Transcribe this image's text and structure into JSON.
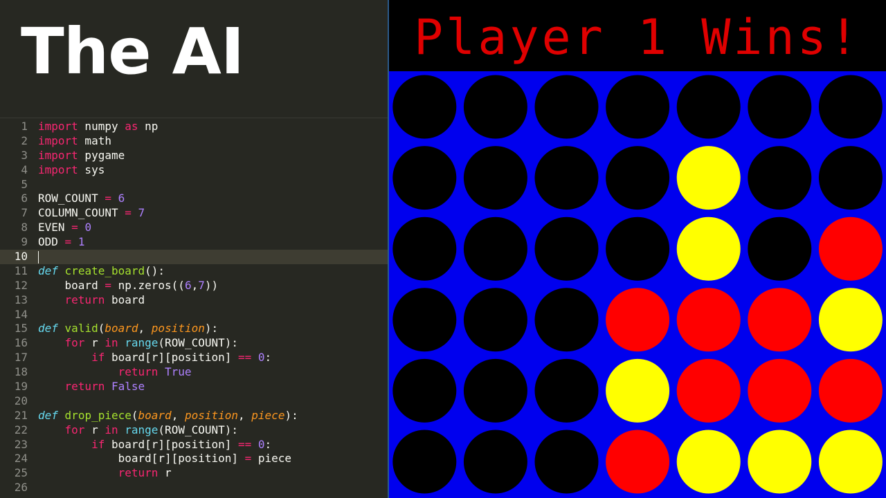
{
  "headline": "The AI",
  "code_lines": [
    [
      [
        "import",
        "#f92672"
      ],
      [
        " numpy ",
        "#f8f8f2"
      ],
      [
        "as",
        "#f92672"
      ],
      [
        " np",
        "#f8f8f2"
      ]
    ],
    [
      [
        "import",
        "#f92672"
      ],
      [
        " math",
        "#f8f8f2"
      ]
    ],
    [
      [
        "import",
        "#f92672"
      ],
      [
        " pygame",
        "#f8f8f2"
      ]
    ],
    [
      [
        "import",
        "#f92672"
      ],
      [
        " sys",
        "#f8f8f2"
      ]
    ],
    [],
    [
      [
        "ROW_COUNT ",
        "#f8f8f2"
      ],
      [
        "=",
        "#f92672"
      ],
      [
        " ",
        "#f8f8f2"
      ],
      [
        "6",
        "#ae81ff"
      ]
    ],
    [
      [
        "COLUMN_COUNT ",
        "#f8f8f2"
      ],
      [
        "=",
        "#f92672"
      ],
      [
        " ",
        "#f8f8f2"
      ],
      [
        "7",
        "#ae81ff"
      ]
    ],
    [
      [
        "EVEN ",
        "#f8f8f2"
      ],
      [
        "=",
        "#f92672"
      ],
      [
        " ",
        "#f8f8f2"
      ],
      [
        "0",
        "#ae81ff"
      ]
    ],
    [
      [
        "ODD ",
        "#f8f8f2"
      ],
      [
        "=",
        "#f92672"
      ],
      [
        " ",
        "#f8f8f2"
      ],
      [
        "1",
        "#ae81ff"
      ]
    ],
    [],
    [
      [
        "def",
        "#66d9ef",
        "i"
      ],
      [
        " ",
        "#f8f8f2"
      ],
      [
        "create_board",
        "#a6e22e"
      ],
      [
        "():",
        "#f8f8f2"
      ]
    ],
    [
      [
        "    board ",
        "#f8f8f2"
      ],
      [
        "=",
        "#f92672"
      ],
      [
        " np.zeros((",
        "#f8f8f2"
      ],
      [
        "6",
        "#ae81ff"
      ],
      [
        ",",
        "#f8f8f2"
      ],
      [
        "7",
        "#ae81ff"
      ],
      [
        "))",
        "#f8f8f2"
      ]
    ],
    [
      [
        "    ",
        "#f8f8f2"
      ],
      [
        "return",
        "#f92672"
      ],
      [
        " board",
        "#f8f8f2"
      ]
    ],
    [],
    [
      [
        "def",
        "#66d9ef",
        "i"
      ],
      [
        " ",
        "#f8f8f2"
      ],
      [
        "valid",
        "#a6e22e"
      ],
      [
        "(",
        "#f8f8f2"
      ],
      [
        "board",
        "#fd971f",
        "i"
      ],
      [
        ", ",
        "#f8f8f2"
      ],
      [
        "position",
        "#fd971f",
        "i"
      ],
      [
        "):",
        "#f8f8f2"
      ]
    ],
    [
      [
        "    ",
        "#f8f8f2"
      ],
      [
        "for",
        "#f92672"
      ],
      [
        " r ",
        "#f8f8f2"
      ],
      [
        "in",
        "#f92672"
      ],
      [
        " ",
        "#f8f8f2"
      ],
      [
        "range",
        "#66d9ef"
      ],
      [
        "(ROW_COUNT):",
        "#f8f8f2"
      ]
    ],
    [
      [
        "        ",
        "#f8f8f2"
      ],
      [
        "if",
        "#f92672"
      ],
      [
        " board[r][position] ",
        "#f8f8f2"
      ],
      [
        "==",
        "#f92672"
      ],
      [
        " ",
        "#f8f8f2"
      ],
      [
        "0",
        "#ae81ff"
      ],
      [
        ":",
        "#f8f8f2"
      ]
    ],
    [
      [
        "            ",
        "#f8f8f2"
      ],
      [
        "return",
        "#f92672"
      ],
      [
        " ",
        "#f8f8f2"
      ],
      [
        "True",
        "#ae81ff"
      ]
    ],
    [
      [
        "    ",
        "#f8f8f2"
      ],
      [
        "return",
        "#f92672"
      ],
      [
        " ",
        "#f8f8f2"
      ],
      [
        "False",
        "#ae81ff"
      ]
    ],
    [],
    [
      [
        "def",
        "#66d9ef",
        "i"
      ],
      [
        " ",
        "#f8f8f2"
      ],
      [
        "drop_piece",
        "#a6e22e"
      ],
      [
        "(",
        "#f8f8f2"
      ],
      [
        "board",
        "#fd971f",
        "i"
      ],
      [
        ", ",
        "#f8f8f2"
      ],
      [
        "position",
        "#fd971f",
        "i"
      ],
      [
        ", ",
        "#f8f8f2"
      ],
      [
        "piece",
        "#fd971f",
        "i"
      ],
      [
        "):",
        "#f8f8f2"
      ]
    ],
    [
      [
        "    ",
        "#f8f8f2"
      ],
      [
        "for",
        "#f92672"
      ],
      [
        " r ",
        "#f8f8f2"
      ],
      [
        "in",
        "#f92672"
      ],
      [
        " ",
        "#f8f8f2"
      ],
      [
        "range",
        "#66d9ef"
      ],
      [
        "(ROW_COUNT):",
        "#f8f8f2"
      ]
    ],
    [
      [
        "        ",
        "#f8f8f2"
      ],
      [
        "if",
        "#f92672"
      ],
      [
        " board[r][position] ",
        "#f8f8f2"
      ],
      [
        "==",
        "#f92672"
      ],
      [
        " ",
        "#f8f8f2"
      ],
      [
        "0",
        "#ae81ff"
      ],
      [
        ":",
        "#f8f8f2"
      ]
    ],
    [
      [
        "            board[r][position] ",
        "#f8f8f2"
      ],
      [
        "=",
        "#f92672"
      ],
      [
        " piece",
        "#f8f8f2"
      ]
    ],
    [
      [
        "            ",
        "#f8f8f2"
      ],
      [
        "return",
        "#f92672"
      ],
      [
        " r",
        "#f8f8f2"
      ]
    ],
    []
  ],
  "current_line": 10,
  "status": "Player 1 Wins!",
  "board_rows": [
    "0000000",
    "0000200",
    "0000201",
    "0001112",
    "0002111",
    "0001222"
  ],
  "colors": {
    "board": "#0000ee",
    "empty": "#000000",
    "player1": "#ff0000",
    "player2": "#ffff00",
    "status_text": "#e00000"
  }
}
